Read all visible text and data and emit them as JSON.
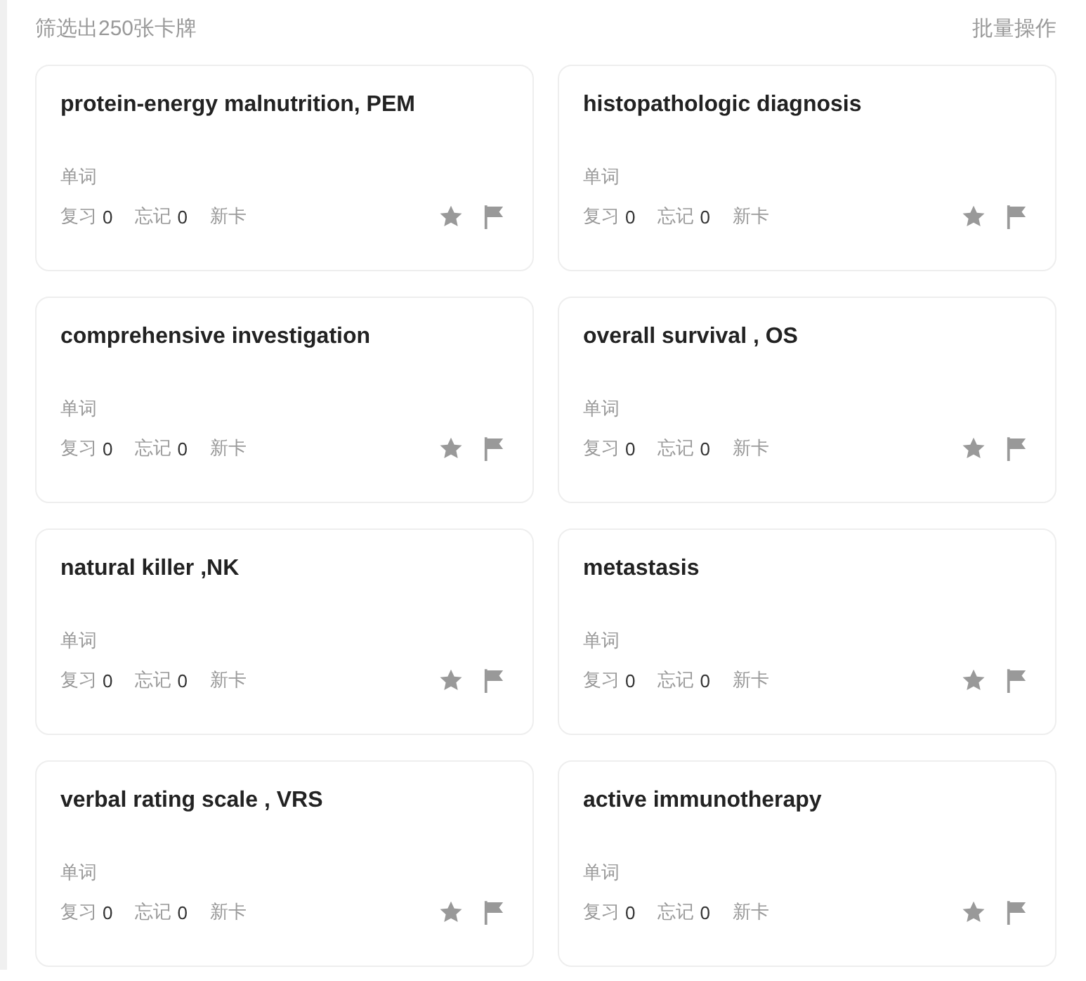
{
  "header": {
    "count_text": "筛选出250张卡牌",
    "batch_action": "批量操作"
  },
  "cards": [
    {
      "term": "protein-energy malnutrition, PEM",
      "type": "单词",
      "review_label": "复习",
      "review": "0",
      "forget_label": "忘记",
      "forget": "0",
      "status": "新卡"
    },
    {
      "term": "histopathologic diagnosis",
      "type": "单词",
      "review_label": "复习",
      "review": "0",
      "forget_label": "忘记",
      "forget": "0",
      "status": "新卡"
    },
    {
      "term": "comprehensive investigation",
      "type": "单词",
      "review_label": "复习",
      "review": "0",
      "forget_label": "忘记",
      "forget": "0",
      "status": "新卡"
    },
    {
      "term": "overall survival , OS",
      "type": "单词",
      "review_label": "复习",
      "review": "0",
      "forget_label": "忘记",
      "forget": "0",
      "status": "新卡"
    },
    {
      "term": "natural killer ,NK",
      "type": "单词",
      "review_label": "复习",
      "review": "0",
      "forget_label": "忘记",
      "forget": "0",
      "status": "新卡"
    },
    {
      "term": "metastasis",
      "type": "单词",
      "review_label": "复习",
      "review": "0",
      "forget_label": "忘记",
      "forget": "0",
      "status": "新卡"
    },
    {
      "term": "verbal rating scale , VRS",
      "type": "单词",
      "review_label": "复习",
      "review": "0",
      "forget_label": "忘记",
      "forget": "0",
      "status": "新卡"
    },
    {
      "term": "active immunotherapy",
      "type": "单词",
      "review_label": "复习",
      "review": "0",
      "forget_label": "忘记",
      "forget": "0",
      "status": "新卡"
    }
  ]
}
